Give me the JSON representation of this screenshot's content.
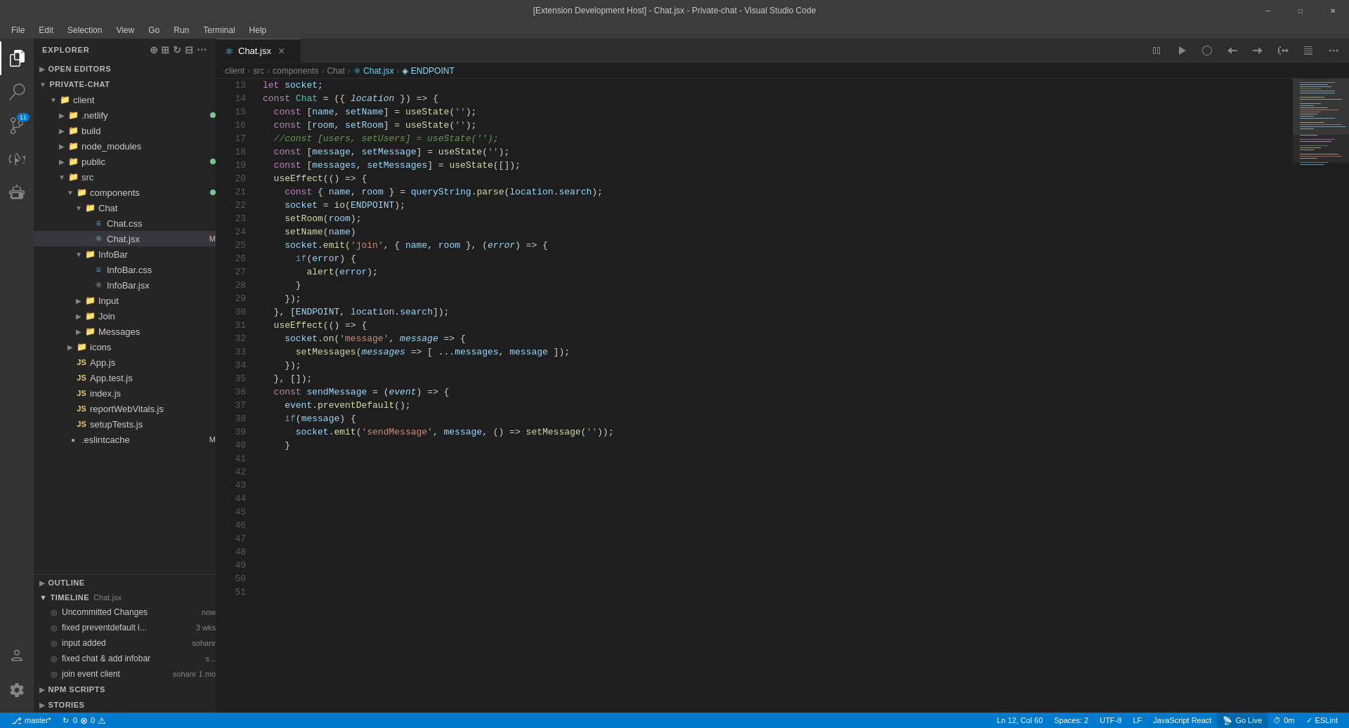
{
  "titlebar": {
    "title": "[Extension Development Host] - Chat.jsx - Private-chat - Visual Studio Code"
  },
  "menubar": {
    "items": [
      "File",
      "Edit",
      "Selection",
      "View",
      "Go",
      "Run",
      "Terminal",
      "Help"
    ]
  },
  "sidebar": {
    "header": "Explorer",
    "open_editors_label": "Open Editors",
    "project_label": "Private-Chat",
    "tree": [
      {
        "id": "client",
        "label": "client",
        "type": "folder",
        "indent": 1,
        "expanded": true
      },
      {
        "id": "netlify",
        "label": ".netlify",
        "type": "folder",
        "indent": 2,
        "expanded": false,
        "badge": "dot-green"
      },
      {
        "id": "build",
        "label": "build",
        "type": "folder",
        "indent": 2,
        "expanded": false
      },
      {
        "id": "node_modules",
        "label": "node_modules",
        "type": "folder",
        "indent": 2,
        "expanded": false
      },
      {
        "id": "public",
        "label": "public",
        "type": "folder",
        "indent": 2,
        "expanded": false,
        "badge": "dot-green"
      },
      {
        "id": "src",
        "label": "src",
        "type": "folder",
        "indent": 2,
        "expanded": true
      },
      {
        "id": "components",
        "label": "components",
        "type": "folder",
        "indent": 3,
        "expanded": true,
        "badge": "dot-green"
      },
      {
        "id": "chat-folder",
        "label": "Chat",
        "type": "folder",
        "indent": 4,
        "expanded": true
      },
      {
        "id": "chat-css",
        "label": "Chat.css",
        "type": "css",
        "indent": 5
      },
      {
        "id": "chat-jsx",
        "label": "Chat.jsx",
        "type": "jsx",
        "indent": 5,
        "badge": "M",
        "active": true
      },
      {
        "id": "infobar",
        "label": "InfoBar",
        "type": "folder",
        "indent": 4,
        "expanded": true
      },
      {
        "id": "infobar-css",
        "label": "InfoBar.css",
        "type": "css",
        "indent": 5
      },
      {
        "id": "infobar-jsx",
        "label": "InfoBar.jsx",
        "type": "jsx",
        "indent": 5
      },
      {
        "id": "input",
        "label": "Input",
        "type": "folder",
        "indent": 4,
        "expanded": false
      },
      {
        "id": "join",
        "label": "Join",
        "type": "folder",
        "indent": 4,
        "expanded": false
      },
      {
        "id": "messages",
        "label": "Messages",
        "type": "folder",
        "indent": 4,
        "expanded": false
      },
      {
        "id": "icons",
        "label": "icons",
        "type": "folder",
        "indent": 3,
        "expanded": false
      },
      {
        "id": "app-js",
        "label": "App.js",
        "type": "js",
        "indent": 3
      },
      {
        "id": "app-test",
        "label": "App.test.js",
        "type": "test",
        "indent": 3
      },
      {
        "id": "index-js",
        "label": "index.js",
        "type": "js",
        "indent": 3
      },
      {
        "id": "report",
        "label": "reportWebVitals.js",
        "type": "js",
        "indent": 3
      },
      {
        "id": "setup",
        "label": "setupTests.js",
        "type": "js",
        "indent": 3
      },
      {
        "id": "eslint",
        "label": ".eslintcache",
        "type": "dot",
        "indent": 2,
        "badge": "M"
      }
    ],
    "outline_label": "Outline",
    "timeline_label": "Timeline",
    "timeline_file": "Chat.jsx",
    "timeline_items": [
      {
        "label": "Uncommitted Changes",
        "meta": "now"
      },
      {
        "label": "fixed preventdefault i...",
        "meta": "3 wks"
      },
      {
        "label": "input added",
        "meta": "sohanr"
      },
      {
        "label": "fixed chat & add infobar",
        "meta": "s..."
      },
      {
        "label": "join event client",
        "meta": "sohanr  1 mo"
      }
    ],
    "npm_scripts_label": "NPM Scripts",
    "stories_label": "Stories"
  },
  "tab": {
    "filename": "Chat.jsx",
    "icon": "jsx"
  },
  "breadcrumb": {
    "parts": [
      "client",
      "src",
      "components",
      "Chat",
      "Chat.jsx",
      "ENDPOINT"
    ]
  },
  "code": {
    "lines": [
      {
        "num": 13,
        "content": ""
      },
      {
        "num": 14,
        "html": "<span class='kw'>let</span> <span class='var'>socket</span><span class='punc'>;</span>"
      },
      {
        "num": 15,
        "content": ""
      },
      {
        "num": 16,
        "html": "<span class='kw'>const</span> <span class='var'>Chat</span> <span class='op'>=</span> <span class='punc'>({</span> <span class='param'>location</span> <span class='punc'>})</span> <span class='arr'>=&gt;</span> <span class='punc'>{</span>"
      },
      {
        "num": 17,
        "html": "  <span class='kw'>const</span> <span class='punc'>[</span><span class='var'>name</span><span class='punc'>,</span> <span class='var'>setName</span><span class='punc'>]</span> <span class='op'>=</span> <span class='fn'>useState</span><span class='punc'>(</span><span class='str'>''</span><span class='punc'>);</span>"
      },
      {
        "num": 18,
        "html": "  <span class='kw'>const</span> <span class='punc'>[</span><span class='var'>room</span><span class='punc'>,</span> <span class='var'>setRoom</span><span class='punc'>]</span> <span class='op'>=</span> <span class='fn'>useState</span><span class='punc'>(</span><span class='str'>''</span><span class='punc'>);</span>"
      },
      {
        "num": 19,
        "html": "  <span class='cmt'>//const [users, setUsers] = useState('');</span>"
      },
      {
        "num": 20,
        "html": "  <span class='kw'>const</span> <span class='punc'>[</span><span class='var'>message</span><span class='punc'>,</span> <span class='var'>setMessage</span><span class='punc'>]</span> <span class='op'>=</span> <span class='fn'>useState</span><span class='punc'>(</span><span class='str'>''</span><span class='punc'>);</span>"
      },
      {
        "num": 21,
        "html": "  <span class='kw'>const</span> <span class='punc'>[</span><span class='var'>messages</span><span class='punc'>,</span> <span class='var'>setMessages</span><span class='punc'>]</span> <span class='op'>=</span> <span class='fn'>useState</span><span class='punc'>(</span><span class='punc'>[]);</span>"
      },
      {
        "num": 22,
        "content": ""
      },
      {
        "num": 23,
        "html": "  <span class='fn'>useEffect</span><span class='punc'>(()</span> <span class='arr'>=&gt;</span> <span class='punc'>{</span>"
      },
      {
        "num": 24,
        "html": "    <span class='kw'>const</span> <span class='punc'>{</span> <span class='var'>name</span><span class='punc'>,</span> <span class='var'>room</span> <span class='punc'>}</span> <span class='op'>=</span> <span class='var'>queryString</span><span class='punc'>.</span><span class='fn'>parse</span><span class='punc'>(</span><span class='var'>location</span><span class='punc'>.</span><span class='prop'>search</span><span class='punc'>);</span>"
      },
      {
        "num": 25,
        "content": ""
      },
      {
        "num": 26,
        "html": "    <span class='var'>socket</span> <span class='op'>=</span> <span class='fn'>io</span><span class='punc'>(</span><span class='var'>ENDPOINT</span><span class='punc'>);</span>"
      },
      {
        "num": 27,
        "content": ""
      },
      {
        "num": 28,
        "html": "    <span class='fn'>setRoom</span><span class='punc'>(</span><span class='var'>room</span><span class='punc'>);</span>"
      },
      {
        "num": 29,
        "html": "    <span class='fn'>setName</span><span class='punc'>(</span><span class='var'>name</span><span class='punc'>)</span>"
      },
      {
        "num": 30,
        "content": ""
      },
      {
        "num": 31,
        "html": "    <span class='var'>socket</span><span class='punc'>.</span><span class='fn'>emit</span><span class='punc'>(</span><span class='str'>'join'</span><span class='punc'>,</span> <span class='punc'>{</span> <span class='var'>name</span><span class='punc'>,</span> <span class='var'>room</span> <span class='punc'>},</span> <span class='punc'>(</span><span class='param'>error</span><span class='punc'>)</span> <span class='arr'>=&gt;</span> <span class='punc'>{</span>"
      },
      {
        "num": 32,
        "html": "      <span class='kw2'>if</span><span class='punc'>(</span><span class='var'>error</span><span class='punc'>)</span> <span class='punc'>{</span>"
      },
      {
        "num": 33,
        "html": "        <span class='fn'>alert</span><span class='punc'>(</span><span class='var'>error</span><span class='punc'>);</span>"
      },
      {
        "num": 34,
        "html": "      <span class='punc'>}</span>"
      },
      {
        "num": 35,
        "html": "    <span class='punc'>});</span>"
      },
      {
        "num": 36,
        "html": "  <span class='punc'>},</span> <span class='punc'>[</span><span class='var'>ENDPOINT</span><span class='punc'>,</span> <span class='var'>location</span><span class='punc'>.</span><span class='prop'>search</span><span class='punc'>]);</span>"
      },
      {
        "num": 37,
        "content": ""
      },
      {
        "num": 38,
        "html": "  <span class='fn'>useEffect</span><span class='punc'>(()</span> <span class='arr'>=&gt;</span> <span class='punc'>{</span>"
      },
      {
        "num": 39,
        "html": "    <span class='var'>socket</span><span class='punc'>.</span><span class='fn'>on</span><span class='punc'>(</span><span class='str'>'message'</span><span class='punc'>,</span> <span class='param'>message</span> <span class='arr'>=&gt;</span> <span class='punc'>{</span>"
      },
      {
        "num": 40,
        "html": "      <span class='fn'>setMessages</span><span class='punc'>(</span><span class='param'>messages</span> <span class='arr'>=&gt;</span> <span class='punc'>[</span> <span class='op'>...</span><span class='var'>messages</span><span class='punc'>,</span> <span class='var'>message</span> <span class='punc'>]);</span>"
      },
      {
        "num": 41,
        "html": "    <span class='punc'>});</span>"
      },
      {
        "num": 42,
        "content": ""
      },
      {
        "num": 43,
        "content": ""
      },
      {
        "num": 44,
        "html": "  <span class='punc'>},</span> <span class='punc'>[]);</span>"
      },
      {
        "num": 45,
        "content": ""
      },
      {
        "num": 46,
        "html": "  <span class='kw'>const</span> <span class='var'>sendMessage</span> <span class='op'>=</span> <span class='punc'>(</span><span class='param'>event</span><span class='punc'>)</span> <span class='arr'>=&gt;</span> <span class='punc'>{</span>"
      },
      {
        "num": 47,
        "html": "    <span class='var'>event</span><span class='punc'>.</span><span class='fn'>preventDefault</span><span class='punc'>();</span>"
      },
      {
        "num": 48,
        "content": ""
      },
      {
        "num": 49,
        "html": "    <span class='kw2'>if</span><span class='punc'>(</span><span class='var'>message</span><span class='punc'>)</span> <span class='punc'>{</span>"
      },
      {
        "num": 50,
        "html": "      <span class='var'>socket</span><span class='punc'>.</span><span class='fn'>emit</span><span class='punc'>(</span><span class='str'>'sendMessage'</span><span class='punc'>,</span> <span class='var'>message</span><span class='punc'>,</span> <span class='punc'>()</span> <span class='arr'>=&gt;</span> <span class='fn'>setMessage</span><span class='punc'>(</span><span class='str'>''</span><span class='punc'>));</span>"
      },
      {
        "num": 51,
        "html": "    <span class='punc'>}</span>"
      }
    ]
  },
  "statusbar": {
    "git_branch": "master*",
    "sync_icon": "↻",
    "errors": "0",
    "warnings": "0",
    "cursor": "Ln 12, Col 60",
    "spaces": "Spaces: 2",
    "encoding": "UTF-8",
    "eol": "LF",
    "language": "JavaScript React",
    "go_live": "Go Live",
    "time": "0m",
    "eslint": "ESLint"
  },
  "colors": {
    "accent": "#007acc",
    "sidebar_bg": "#252526",
    "editor_bg": "#1e1e1e",
    "tabbar_bg": "#2d2d2d",
    "statusbar_bg": "#007acc"
  }
}
